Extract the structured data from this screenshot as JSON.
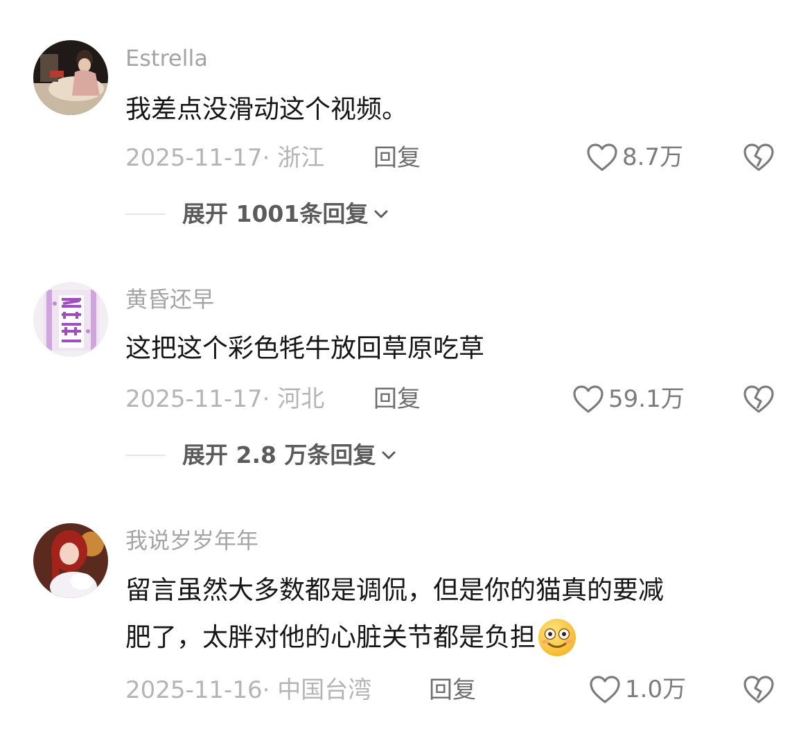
{
  "comments": [
    {
      "username": "Estrella",
      "text": [
        "我差点没滑动这个视频。"
      ],
      "date_location": "2025-11-17· 浙江",
      "reply_label": "回复",
      "likes": "8.7万",
      "expand_label": "展开 1001条回复"
    },
    {
      "username": "黄昏还早",
      "text": [
        "这把这个彩色牦牛放回草原吃草"
      ],
      "date_location": "2025-11-17· 河北",
      "reply_label": "回复",
      "likes": "59.1万",
      "expand_label": "展开 2.8 万条回复"
    },
    {
      "username": "我说岁岁年年",
      "text": [
        "留言虽然大多数都是调侃，但是你的猫真的要减",
        "肥了，太胖对他的心脏关节都是负担"
      ],
      "date_location": "2025-11-16· 中国台湾",
      "reply_label": "回复",
      "likes": "1.0万"
    }
  ],
  "icons": {
    "like": "heart-outline-icon",
    "dislike": "broken-heart-icon",
    "expand": "chevron-down-icon",
    "emoji": "smiling-face-emoji"
  },
  "colors": {
    "username": "#a4a4a4",
    "text": "#161616",
    "meta": "#b4b4b4",
    "avatar2_accent": "#b264c8"
  }
}
